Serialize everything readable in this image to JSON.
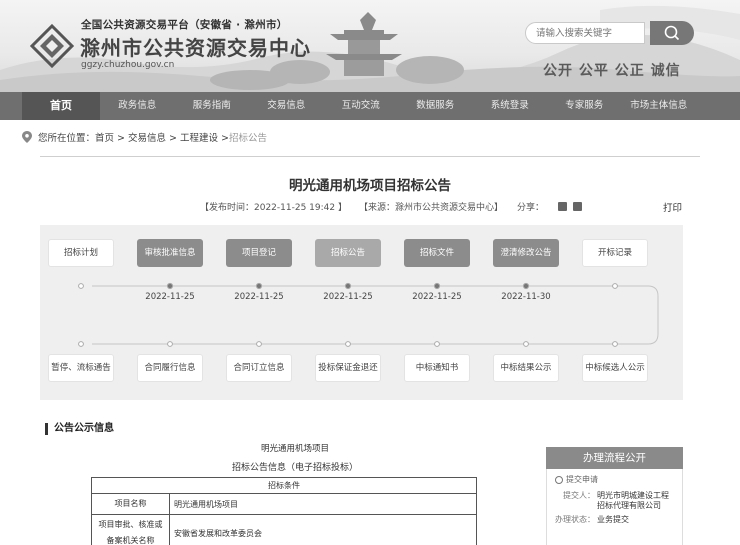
{
  "header": {
    "platform_line": "全国公共资源交易平台（安徽省 · 滁州市）",
    "org_name": "滁州市公共资源交易中心",
    "url": "ggzy.chuzhou.gov.cn",
    "search_placeholder": "请输入搜索关键字",
    "slogan": "公开 公平 公正 诚信"
  },
  "nav": [
    {
      "label": "首页",
      "active": true
    },
    {
      "label": "政务信息"
    },
    {
      "label": "服务指南"
    },
    {
      "label": "交易信息"
    },
    {
      "label": "互动交流"
    },
    {
      "label": "数据服务"
    },
    {
      "label": "系统登录"
    },
    {
      "label": "专家服务"
    },
    {
      "label": "市场主体信息"
    }
  ],
  "breadcrumb": {
    "prefix": "您所在位置：",
    "path": "首页 > 交易信息 > 工程建设 > ",
    "current": "招标公告"
  },
  "article": {
    "title": "明光通用机场项目招标公告",
    "publish_time": "【发布时间：2022-11-25 19:42 】",
    "source": "【来源：滁州市公共资源交易中心】",
    "share_label": "分享：",
    "print_label": "打印"
  },
  "flow": {
    "top": [
      {
        "label": "招标计划",
        "date": "",
        "state": "off"
      },
      {
        "label": "审核批准信息",
        "date": "2022-11-25",
        "state": "on"
      },
      {
        "label": "项目登记",
        "date": "2022-11-25",
        "state": "on"
      },
      {
        "label": "招标公告",
        "date": "2022-11-25",
        "state": "on2"
      },
      {
        "label": "招标文件",
        "date": "2022-11-25",
        "state": "on"
      },
      {
        "label": "澄清修改公告",
        "date": "2022-11-30",
        "state": "on"
      },
      {
        "label": "开标记录",
        "date": "",
        "state": "off"
      }
    ],
    "bottom": [
      {
        "label": "暂停、流标通告"
      },
      {
        "label": "合同履行信息"
      },
      {
        "label": "合同订立信息"
      },
      {
        "label": "投标保证金退还"
      },
      {
        "label": "中标通知书"
      },
      {
        "label": "中标结果公示"
      },
      {
        "label": "中标候选人公示"
      }
    ]
  },
  "section": {
    "title": "公告公示信息",
    "doc_title": "明光通用机场项目",
    "doc_subtitle": "招标公告信息（电子招标投标）",
    "table_header": "招标条件",
    "rows": [
      {
        "k": "项目名称",
        "v": "明光通用机场项目"
      },
      {
        "k": "项目审批、核准或备案机关名称",
        "v": "安徽省发展和改革委员会"
      }
    ]
  },
  "side": {
    "title": "办理流程公开",
    "step": "提交申请",
    "rows": [
      {
        "k": "提交人：",
        "v": "明光市明城建设工程招标代理有限公司"
      },
      {
        "k": "办理状态：",
        "v": "业务提交"
      }
    ]
  }
}
